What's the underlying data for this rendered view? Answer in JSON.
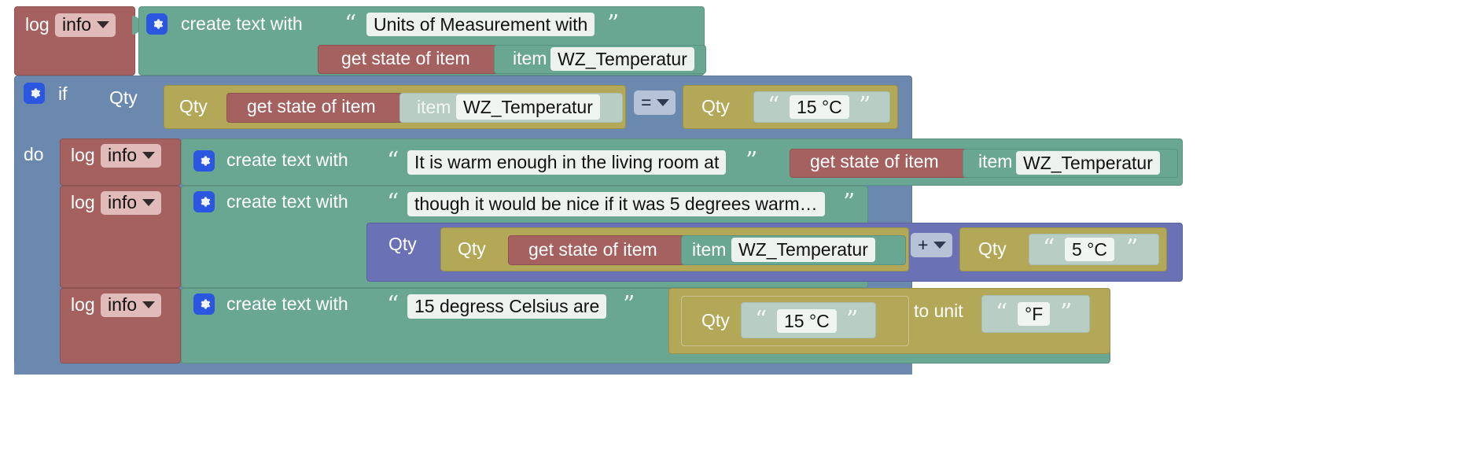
{
  "editor": {
    "name": "blockly-workspace",
    "background": "#ffffff"
  },
  "colors": {
    "log_block": "#a5615f",
    "text_block": "#6aa793",
    "control_block": "#6b89ae",
    "quantity_block": "#b3a758",
    "math_block": "#6a71b5",
    "string_field": "#b8cdc4",
    "gear_icon": "#2b56e0"
  },
  "blocks": {
    "log1": {
      "log_label": "log",
      "level": "info",
      "create_text_label": "create text with",
      "string1": "Units of Measurement with",
      "get_state_label": "get state of item",
      "item_label": "item",
      "item_name": "WZ_Temperatur"
    },
    "if_block": {
      "if_label": "if",
      "do_label": "do",
      "qty_outer_label": "Qty",
      "qty_inner_label": "Qty",
      "get_state_label": "get state of item",
      "item_label": "item",
      "item_name": "WZ_Temperatur",
      "operator": "=",
      "qty_right_label": "Qty",
      "compare_value": "15 °C"
    },
    "log2": {
      "log_label": "log",
      "level": "info",
      "create_text_label": "create text with",
      "string1": "It is warm enough in the living room at",
      "get_state_label": "get state of item",
      "item_label": "item",
      "item_name": "WZ_Temperatur"
    },
    "log3": {
      "log_label": "log",
      "level": "info",
      "create_text_label": "create text with",
      "string1": "though it would be nice if it was 5 degrees warm…",
      "qty_outer_label": "Qty",
      "qty_inner_label": "Qty",
      "get_state_label": "get state of item",
      "item_label": "item",
      "item_name": "WZ_Temperatur",
      "operator": "+",
      "qty_right_label": "Qty",
      "addend_value": "5 °C"
    },
    "log4": {
      "log_label": "log",
      "level": "info",
      "create_text_label": "create text with",
      "string1": "15 degress Celsius are",
      "qty_label": "Qty",
      "qty_value": "15 °C",
      "to_unit_label": "to unit",
      "unit_value": "°F"
    }
  },
  "glyphs": {
    "quote_open": "“",
    "quote_close": "”"
  }
}
